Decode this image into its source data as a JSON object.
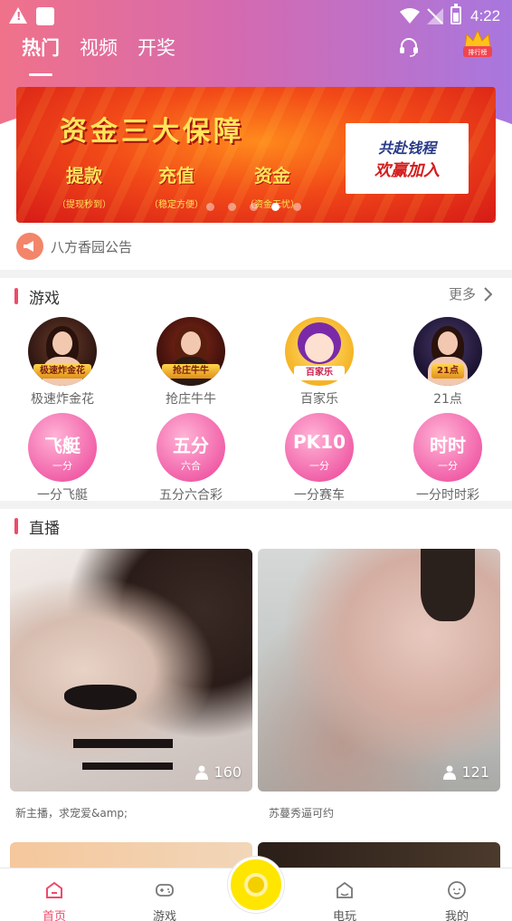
{
  "status_bar": {
    "time": "4:22"
  },
  "top_tabs": [
    {
      "label": "热门",
      "active": true
    },
    {
      "label": "视频",
      "active": false
    },
    {
      "label": "开奖",
      "active": false
    }
  ],
  "rank_badge": {
    "label": "排行榜"
  },
  "banner": {
    "title": "资金三大保障",
    "items": [
      {
        "big": "提款",
        "small": "（提现秒到）"
      },
      {
        "big": "充值",
        "small": "（稳定方便）"
      },
      {
        "big": "资金",
        "small": "（资金无忧）"
      }
    ],
    "card_line1": "共赴钱程",
    "card_line2": "欢赢加入",
    "slide_count": 5,
    "active_slide": 4
  },
  "notice": {
    "text": "八方香园公告"
  },
  "games_section": {
    "title": "游戏",
    "more_label": "更多",
    "games": [
      {
        "name": "极速炸金花",
        "badge": "极速炸金花",
        "icon": "portrait-icon"
      },
      {
        "name": "抢庄牛牛",
        "badge": "抢庄牛牛",
        "icon": "portrait-icon"
      },
      {
        "name": "百家乐",
        "badge": "百家乐",
        "icon": "cartoon-icon"
      },
      {
        "name": "21点",
        "badge": "21点",
        "icon": "portrait-icon"
      },
      {
        "name": "一分飞艇",
        "main": "飞艇",
        "sub": "一分",
        "icon": "lottery-icon"
      },
      {
        "name": "五分六合彩",
        "main": "五分",
        "sub": "六合",
        "icon": "lottery-icon"
      },
      {
        "name": "一分赛车",
        "main": "PK10",
        "sub": "一分",
        "icon": "lottery-icon"
      },
      {
        "name": "一分时时彩",
        "main": "时时",
        "sub": "一分",
        "icon": "lottery-icon"
      }
    ]
  },
  "live_section": {
    "title": "直播",
    "rooms": [
      {
        "viewers": "160",
        "caption": "新主播，求宠爱&amp;"
      },
      {
        "viewers": "121",
        "caption": "苏蔓秀逼可约"
      }
    ]
  },
  "bottom_nav": [
    {
      "label": "首页",
      "active": true,
      "icon": "home-icon"
    },
    {
      "label": "游戏",
      "active": false,
      "icon": "gamepad-icon"
    },
    {
      "label": "电玩",
      "active": false,
      "icon": "arcade-icon"
    },
    {
      "label": "我的",
      "active": false,
      "icon": "profile-icon"
    }
  ],
  "colors": {
    "accent": "#f04a6a",
    "header_start": "#f0728a",
    "header_end": "#a877df",
    "center_button": "#ffe600"
  }
}
